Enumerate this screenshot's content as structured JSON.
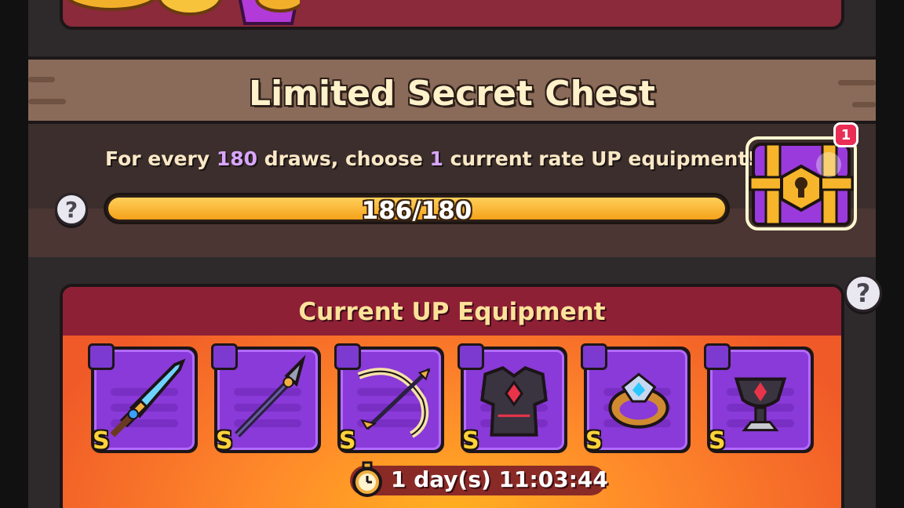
{
  "section": {
    "title": "Limited Secret Chest",
    "desc_prefix": "For every ",
    "draws_needed": "180",
    "desc_mid": " draws, choose ",
    "choose_count": "1",
    "desc_suffix": " current rate UP equipment!",
    "progress_text": "186/180",
    "progress_fraction": 1.0,
    "chest_badge": "1",
    "help_glyph": "?"
  },
  "up_panel": {
    "title": "Current UP Equipment",
    "help_glyph": "?",
    "items": [
      {
        "grade": "S",
        "slot": "sword-slot-icon",
        "art": "sword-icon"
      },
      {
        "grade": "S",
        "slot": "sword-slot-icon",
        "art": "spear-icon"
      },
      {
        "grade": "S",
        "slot": "sword-slot-icon",
        "art": "bow-icon"
      },
      {
        "grade": "S",
        "slot": "armor-slot-icon",
        "art": "armor-icon"
      },
      {
        "grade": "S",
        "slot": "ring-slot-icon",
        "art": "ring-icon"
      },
      {
        "grade": "S",
        "slot": "necklace-slot-icon",
        "art": "necklace-icon"
      }
    ],
    "timer": "1 day(s) 11:03:44"
  },
  "colors": {
    "accent_purple": "#d8a6ff",
    "panel_header": "#8e2036",
    "title_gold": "#ffe29a",
    "progress_fill": "#f5a21a"
  }
}
